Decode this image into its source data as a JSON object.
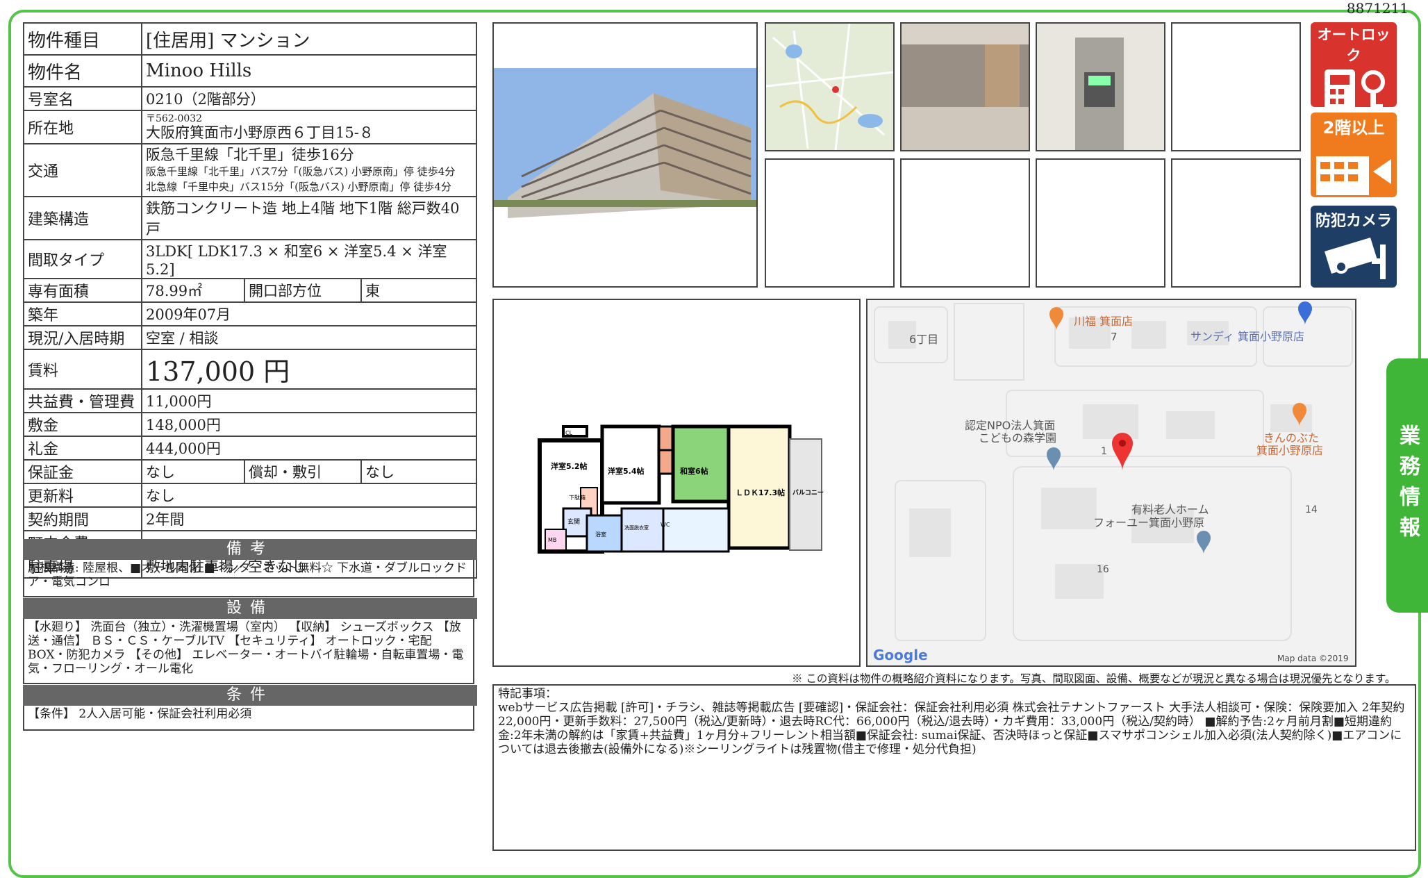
{
  "doc_id": "8871211",
  "spec": {
    "type_label": "物件種目",
    "type_value": "[住居用] マンション",
    "name_label": "物件名",
    "name_value": "Minoo Hills",
    "room_label": "号室名",
    "room_value": "0210（2階部分）",
    "addr_label": "所在地",
    "addr_zip": "〒562-0032",
    "addr_value": "大阪府箕面市小野原西６丁目15-８",
    "access_label": "交通",
    "access_1": "阪急千里線「北千里」徒歩16分",
    "access_2": "阪急千里線「北千里」バス7分「(阪急バス) 小野原南」停 徒歩4分",
    "access_3": "北急線「千里中央」バス15分「(阪急バス) 小野原南」停 徒歩4分",
    "struct_label": "建築構造",
    "struct_value": "鉄筋コンクリート造 地上4階 地下1階 総戸数40戸",
    "layout_label": "間取タイプ",
    "layout_value": "3LDK[ LDK17.3 × 和室6 × 洋室5.4 × 洋室5.2]",
    "area_label": "専有面積",
    "area_value": "78.99㎡",
    "dir_label": "開口部方位",
    "dir_value": "東",
    "built_label": "築年",
    "built_value": "2009年07月",
    "status_label": "現況/入居時期",
    "status_value": "空室 / 相談",
    "rent_label": "賃料",
    "rent_value": "137,000 円",
    "fee_label": "共益費・管理費",
    "fee_value": "11,000円",
    "deposit_label": "敷金",
    "deposit_value": "148,000円",
    "key_label": "礼金",
    "key_value": "444,000円",
    "guarantee_label": "保証金",
    "guarantee_value": "なし",
    "amort_label": "償却・敷引",
    "amort_value": "なし",
    "renew_label": "更新料",
    "renew_value": "なし",
    "contract_label": "契約期間",
    "contract_value": "2年間",
    "assoc_label": "町内会費",
    "assoc_value": "",
    "parking_label": "駐車場",
    "parking_value": "敷地内駐車場／空きなし"
  },
  "biko": {
    "title": "備考",
    "text": "屋根構造: 陸屋根、■オール電化 ■インターネット無料☆ 下水道・ダブルロックドア・電気コンロ"
  },
  "setsubi": {
    "title": "設備",
    "text": "【水廻り】 洗面台（独立）・洗濯機置場（室内） 【収納】 シューズボックス 【放送・通信】 ＢＳ・ＣＳ・ケーブルTV 【セキュリティ】 オートロック・宅配BOX・防犯カメラ 【その他】 エレベーター・オートバイ駐輪場・自転車置場・電気・フローリング・オール電化"
  },
  "joken": {
    "title": "条件",
    "text": "【条件】 2人入居可能・保証会社利用必須"
  },
  "icons": {
    "autolock": "オートロック",
    "floor2": "2階以上",
    "camera": "防犯カメラ"
  },
  "side_tab": "業務情報",
  "floorplan": {
    "room1": "洋室5.2帖",
    "room2": "洋室5.4帖",
    "room3": "和室6帖",
    "ldk": "ＬＤＫ17.3帖",
    "balcony": "バルコニー",
    "cl": "CL",
    "entry": "玄関",
    "storage": "下駄箱",
    "wc": "WC",
    "bath": "浴室",
    "washroom": "洗面脱衣室",
    "mb": "MB"
  },
  "map": {
    "label_6chome": "6丁目",
    "poi_kawafuku": "川福 箕面店",
    "poi_7": "7",
    "poi_sandy": "サンディ 箕面小野原店",
    "poi_npo_1": "認定NPO法人箕面",
    "poi_npo_2": "こどもの森学園",
    "poi_kinnobuta_1": "きんのぶた",
    "poi_kinnobuta_2": "箕面小野原店",
    "poi_home_1": "有料老人ホーム",
    "poi_home_2": "フォーユー箕面小野原",
    "num_14": "14",
    "num_16": "16",
    "num_1": "1",
    "google": "Google",
    "mapdata": "Map data ©2019"
  },
  "note": "※ この資料は物件の概略紹介資料になります。写真、間取図面、設備、概要などが現況と異なる場合は現況優先となります。",
  "remarks": {
    "title": "特記事項：",
    "text": "webサービス広告掲載 [許可]・チラシ、雑誌等掲載広告 [要確認]・保証会社：保証会社利用必須 株式会社テナントファースト 大手法人相談可・保険：保険要加入 2年契約 22,000円・更新手数料：27,500円（税込/更新時）・退去時RC代：66,000円（税込/退去時）・カギ費用：33,000円（税込/契約時） ■解約予告:2ヶ月前月割■短期違約金:2年未満の解約は「家賃+共益費」1ヶ月分+フリーレント相当額■保証会社: sumai保証、否決時ほっと保証■スマサポコンシェル加入必須(法人契約除く)■エアコンについては退去後撤去(設備外になる)※シーリングライトは残置物(借主で修理・処分代負担)"
  }
}
